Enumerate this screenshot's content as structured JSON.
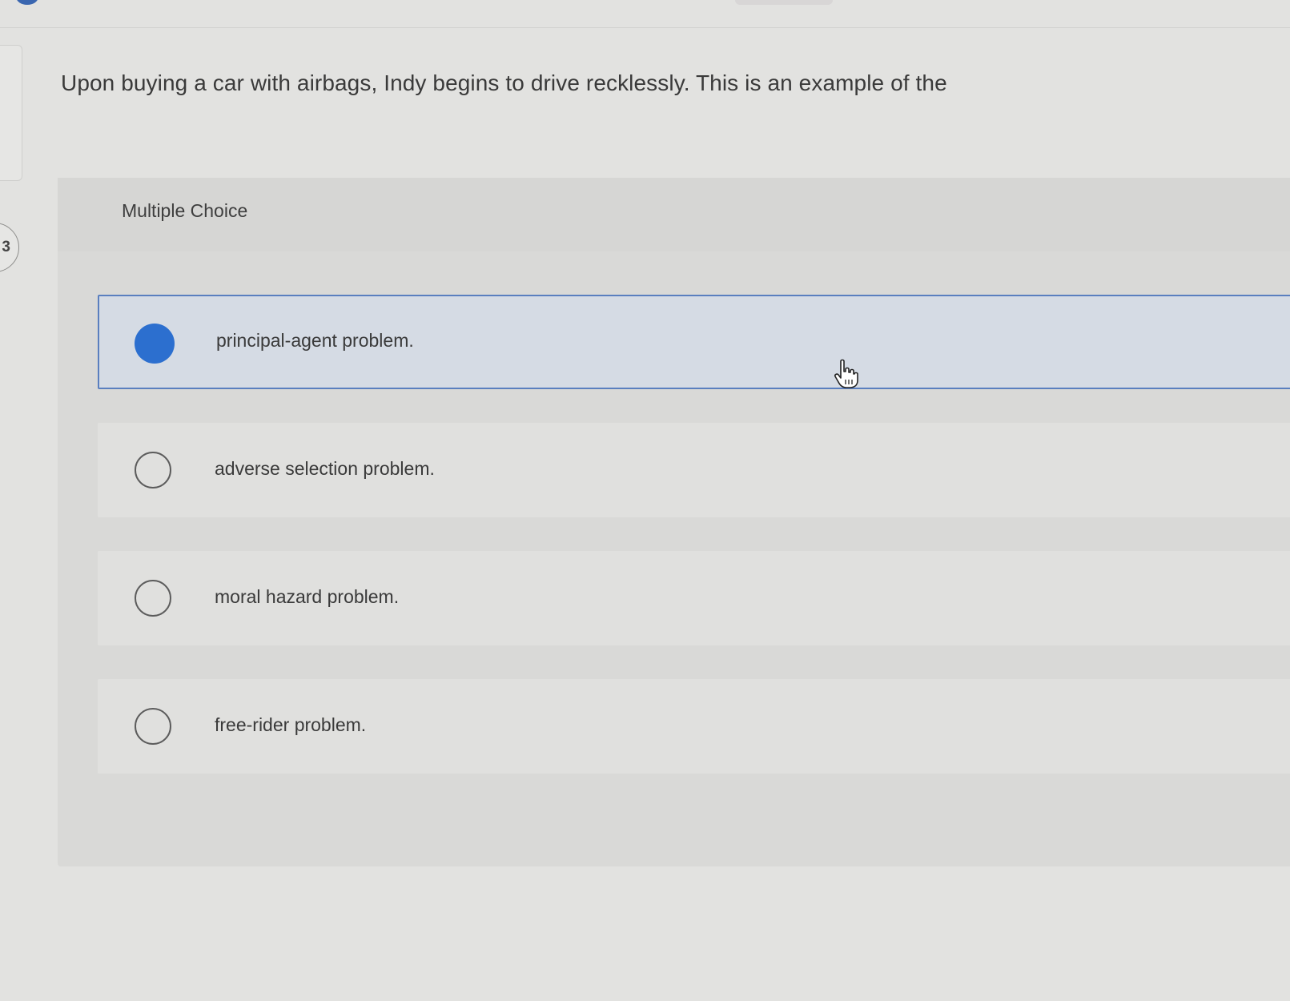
{
  "question": {
    "number": "3",
    "prompt": "Upon buying a car with airbags, Indy begins to drive recklessly. This is an example of the"
  },
  "answer_panel": {
    "type_label": "Multiple Choice",
    "options": [
      {
        "label": "principal-agent problem.",
        "selected": true
      },
      {
        "label": "adverse selection problem.",
        "selected": false
      },
      {
        "label": "moral hazard problem.",
        "selected": false
      },
      {
        "label": "free-rider problem.",
        "selected": false
      }
    ]
  },
  "colors": {
    "selected_radio": "#2c6fcf",
    "selected_border": "#5a7fbf",
    "page_background": "#e2e2e0"
  },
  "icons": {
    "cursor": "hand-pointer-icon"
  }
}
